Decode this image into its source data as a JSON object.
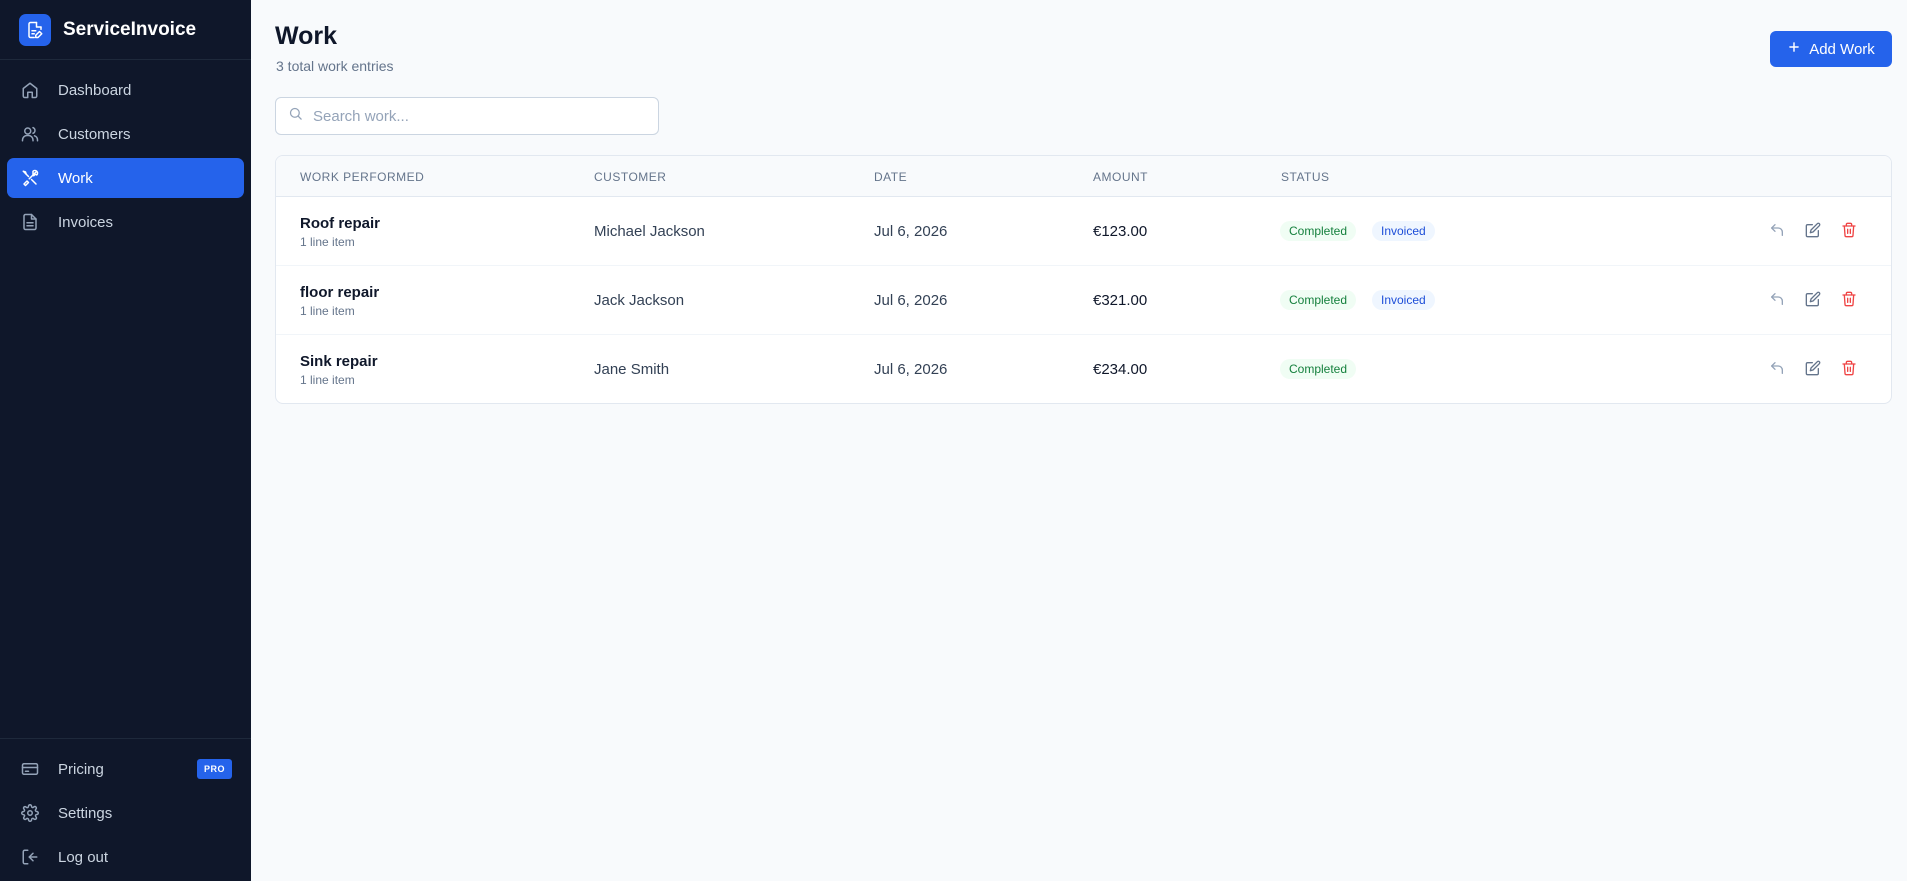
{
  "app": {
    "name": "ServiceInvoice"
  },
  "sidebar": {
    "items": [
      {
        "label": "Dashboard",
        "icon": "home-icon"
      },
      {
        "label": "Customers",
        "icon": "users-icon"
      },
      {
        "label": "Work",
        "icon": "tools-icon",
        "active": true
      },
      {
        "label": "Invoices",
        "icon": "document-icon"
      }
    ],
    "bottom": [
      {
        "label": "Pricing",
        "icon": "credit-card-icon",
        "badge": "PRO"
      },
      {
        "label": "Settings",
        "icon": "gear-icon"
      },
      {
        "label": "Log out",
        "icon": "logout-icon"
      }
    ]
  },
  "page": {
    "title": "Work",
    "subtitle": "3 total work entries",
    "add_label": "Add Work"
  },
  "search": {
    "placeholder": "Search work...",
    "value": ""
  },
  "table": {
    "columns": [
      "WORK PERFORMED",
      "CUSTOMER",
      "DATE",
      "AMOUNT",
      "STATUS"
    ],
    "rows": [
      {
        "title": "Roof repair",
        "sub": "1 line item",
        "customer": "Michael Jackson",
        "date": "Jul 6, 2026",
        "amount": "€123.00",
        "status": "Completed",
        "invoiced": "Invoiced"
      },
      {
        "title": "floor repair",
        "sub": "1 line item",
        "customer": "Jack Jackson",
        "date": "Jul 6, 2026",
        "amount": "€321.00",
        "status": "Completed",
        "invoiced": "Invoiced"
      },
      {
        "title": "Sink repair",
        "sub": "1 line item",
        "customer": "Jane Smith",
        "date": "Jul 6, 2026",
        "amount": "€234.00",
        "status": "Completed",
        "invoiced": null
      }
    ]
  },
  "colors": {
    "sidebar_bg": "#0f172a",
    "accent": "#2563eb",
    "completed_text": "#15803d",
    "invoiced_text": "#1d4ed8",
    "danger": "#ef4444"
  }
}
